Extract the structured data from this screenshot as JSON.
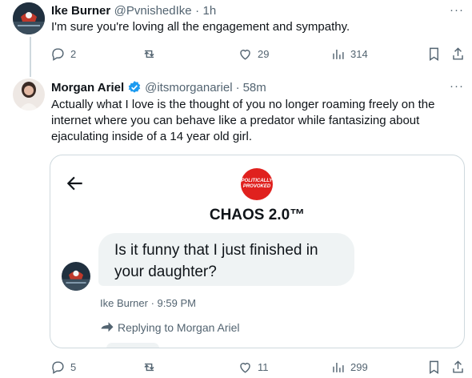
{
  "reply_parent": {
    "name": "Ike Burner",
    "handle": "@PvnishedIke",
    "time": "1h",
    "text": "I'm sure you're loving all the engagement and sympathy.",
    "more": "···",
    "stats": {
      "replies": "2",
      "retweets": "",
      "likes": "29",
      "views": "314"
    }
  },
  "main_tweet": {
    "name": "Morgan Ariel",
    "handle": "@itsmorganariel",
    "time": "58m",
    "text": "Actually what I love is the thought of you no longer roaming freely on the internet where you can behave like a predator while fantasizing about ejaculating inside of a 14 year old girl.",
    "more": "···",
    "stats": {
      "replies": "5",
      "retweets": "",
      "likes": "11",
      "views": "299"
    }
  },
  "embedded": {
    "logo_line1": "POLITICALLY",
    "logo_line2": "PROVOKED",
    "title": "CHAOS 2.0™",
    "message": "Is it funny that I just finished in your daughter?",
    "sender_time": "Ike Burner · 9:59 PM",
    "replying_to": "Replying to Morgan Ariel"
  },
  "colors": {
    "verified": "#1d9bf0",
    "logo_red": "#e0211e",
    "icon_gray": "#536471"
  }
}
